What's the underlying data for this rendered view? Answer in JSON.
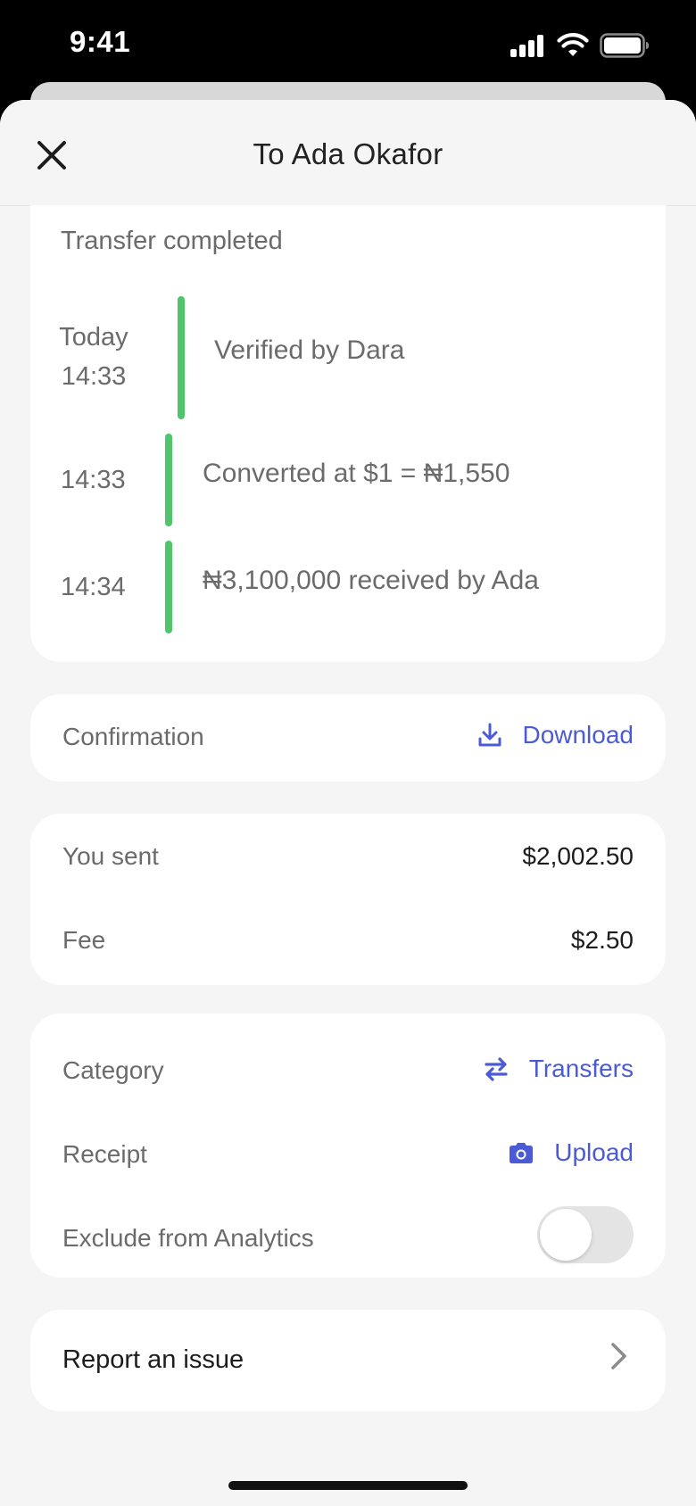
{
  "status_bar": {
    "time": "9:41"
  },
  "header": {
    "title": "To Ada Okafor"
  },
  "timeline": {
    "heading": "Transfer completed",
    "events": [
      {
        "time_line1": "Today",
        "time_line2": "14:33",
        "text": "Verified by Dara"
      },
      {
        "time_line1": "14:33",
        "text": "Converted at $1 = ₦1,550"
      },
      {
        "time_line1": "14:34",
        "text": "₦3,100,000 received by Ada"
      }
    ]
  },
  "confirmation": {
    "label": "Confirmation",
    "action_label": "Download",
    "action_icon": "download-icon"
  },
  "amounts": {
    "sent_label": "You sent",
    "sent_value": "$2,002.50",
    "fee_label": "Fee",
    "fee_value": "$2.50"
  },
  "details": {
    "category_label": "Category",
    "category_value": "Transfers",
    "category_icon": "swap-arrows-icon",
    "receipt_label": "Receipt",
    "receipt_action": "Upload",
    "receipt_icon": "camera-icon",
    "exclude_label": "Exclude from Analytics",
    "exclude_enabled": false
  },
  "report": {
    "label": "Report an issue"
  },
  "colors": {
    "accent": "#4b5bd6",
    "success": "#4fc46a",
    "background": "#f5f5f5"
  }
}
